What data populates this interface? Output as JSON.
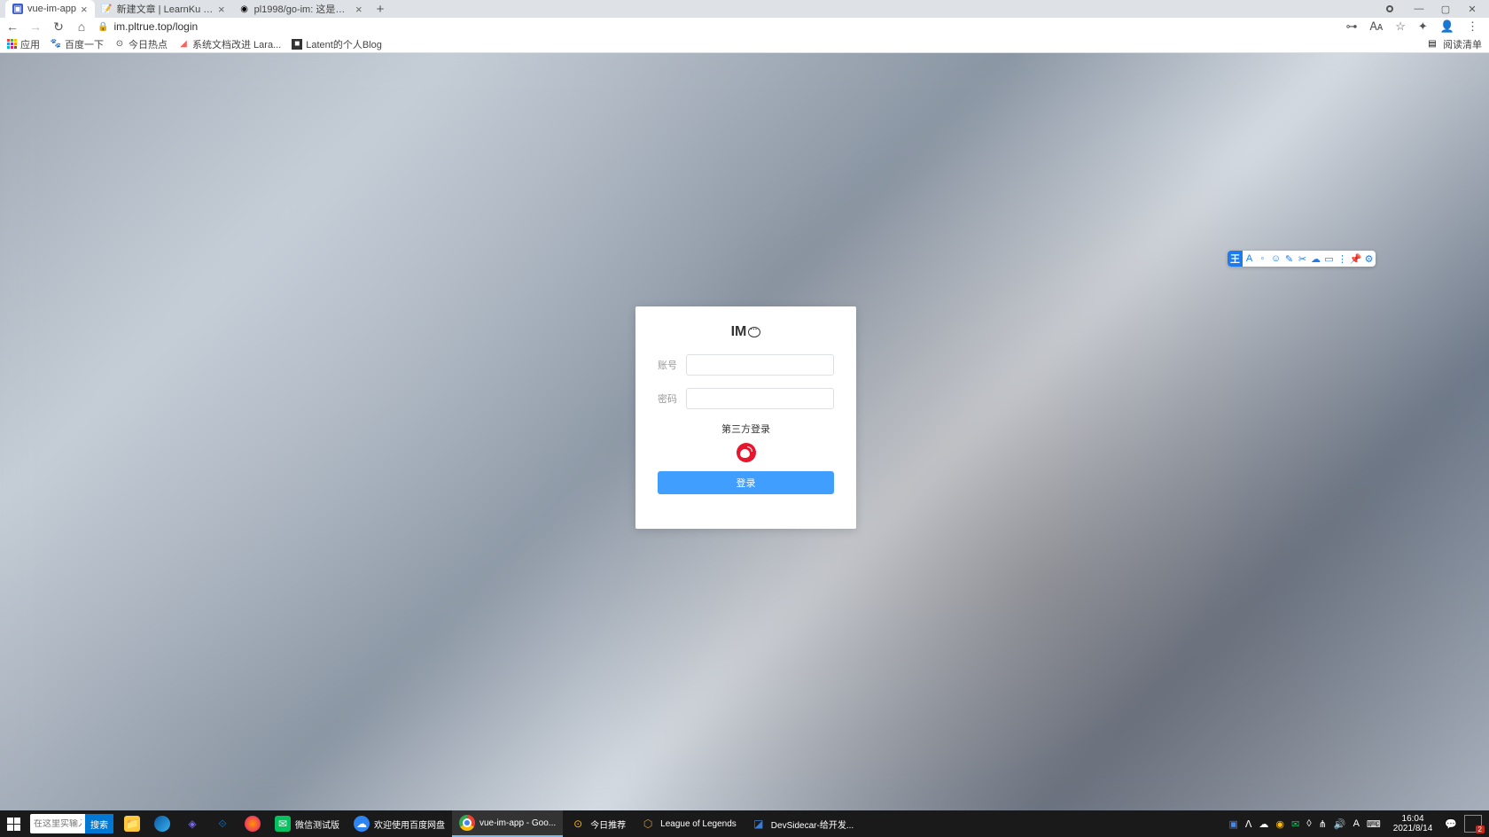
{
  "browser": {
    "tabs": [
      {
        "title": "vue-im-app"
      },
      {
        "title": "新建文章 | LearnKu 终身编程者..."
      },
      {
        "title": "pl1998/go-im: 这是一个golan..."
      }
    ],
    "url": "im.pltrue.top/login",
    "bookmarks": [
      {
        "label": "应用"
      },
      {
        "label": "百度一下"
      },
      {
        "label": "今日热点"
      },
      {
        "label": "系统文档改进 Lara..."
      },
      {
        "label": "Latent的个人Blog"
      }
    ],
    "reading_list": "阅读清单"
  },
  "login": {
    "logo_text": "IM",
    "username_label": "账号",
    "password_label": "密码",
    "third_party_label": "第三方登录",
    "button_label": "登录"
  },
  "annotation_toolbar": {
    "primary": "王"
  },
  "taskbar": {
    "search_placeholder": "在这里实输入搜...",
    "search_btn": "搜索",
    "items": [
      {
        "label": "微信测试版"
      },
      {
        "label": "欢迎使用百度网盘"
      },
      {
        "label": "vue-im-app - Goo..."
      },
      {
        "label": "今日推荐"
      },
      {
        "label": "League of Legends"
      },
      {
        "label": "DevSidecar-给开发..."
      }
    ],
    "clock": {
      "time": "16:04",
      "date": "2021/8/14"
    },
    "notif_count": "2"
  }
}
